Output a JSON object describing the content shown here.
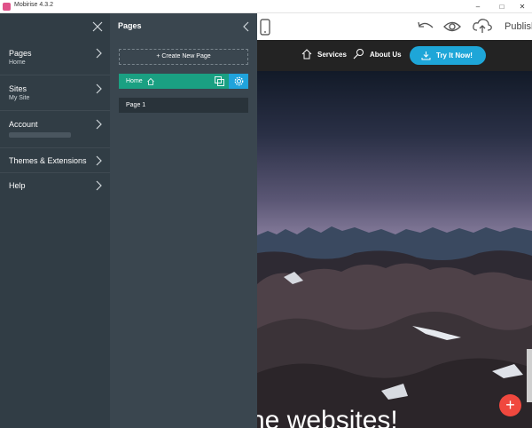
{
  "window": {
    "title": "Mobirise 4.3.2",
    "controls": [
      "minimize-icon",
      "maximize-icon",
      "close-icon"
    ]
  },
  "toolbar": {
    "device_icon": "mobile-icon",
    "undo_icon": "undo-icon",
    "preview_icon": "eye-icon",
    "publish_label": "Publish"
  },
  "sidebar": {
    "close_icon": "close-icon",
    "items": [
      {
        "title": "Pages",
        "subtitle": "Home"
      },
      {
        "title": "Sites",
        "subtitle": "My Site"
      },
      {
        "title": "Account",
        "subtitle": ""
      },
      {
        "title": "Themes & Extensions",
        "subtitle": ""
      },
      {
        "title": "Help",
        "subtitle": ""
      }
    ]
  },
  "pages_panel": {
    "title": "Pages",
    "create_label": "+ Create New Page",
    "pages": [
      {
        "label": "Home",
        "active": true
      },
      {
        "label": "Page 1",
        "active": false
      }
    ]
  },
  "site_preview": {
    "nav": {
      "services": "Services",
      "about": "About Us",
      "cta": "Try It Now!"
    },
    "headline": "ne websites!"
  },
  "colors": {
    "sidebar_bg": "#313d45",
    "panel_bg": "#3a464f",
    "active_page": "#1aa082",
    "accent_blue": "#20a3dc",
    "fab_red": "#f0483e"
  }
}
